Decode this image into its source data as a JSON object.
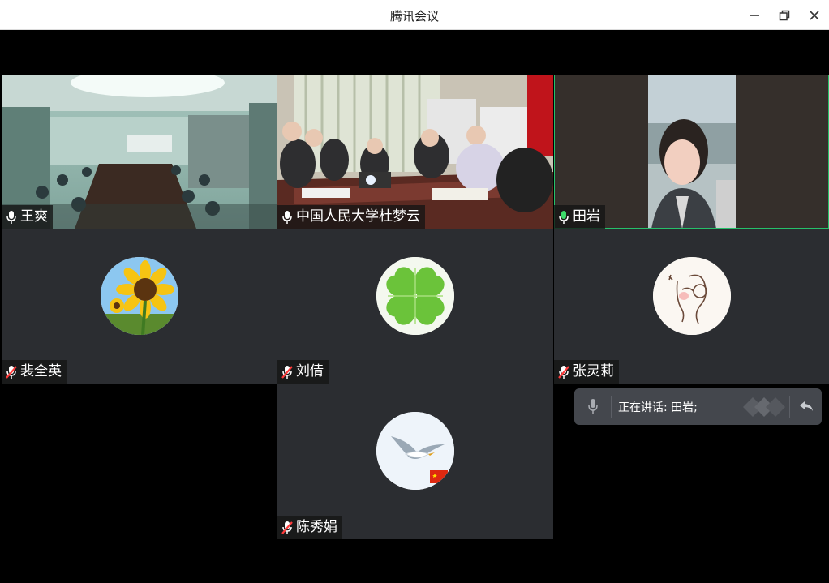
{
  "window": {
    "title": "腾讯会议"
  },
  "participants": [
    {
      "name": "王爽",
      "mic": "on",
      "type": "video"
    },
    {
      "name": "中国人民大学杜梦云",
      "mic": "on",
      "type": "video"
    },
    {
      "name": "田岩",
      "mic": "speaking",
      "type": "video"
    },
    {
      "name": "裴全英",
      "mic": "muted",
      "type": "avatar",
      "avatar_icon": "sunflower-avatar"
    },
    {
      "name": "刘倩",
      "mic": "muted",
      "type": "avatar",
      "avatar_icon": "clover-avatar"
    },
    {
      "name": "张灵莉",
      "mic": "muted",
      "type": "avatar",
      "avatar_icon": "sketch-avatar"
    },
    {
      "name": "陈秀娟",
      "mic": "muted",
      "type": "avatar",
      "avatar_icon": "seagull-avatar"
    }
  ],
  "speaking_panel": {
    "label": "正在讲话: 田岩;"
  },
  "colors": {
    "speaking_border": "#26c06a",
    "mic_active": "#3ddc6a",
    "mic_muted": "#ff3b3b",
    "tile_bg": "#2b2d31"
  }
}
